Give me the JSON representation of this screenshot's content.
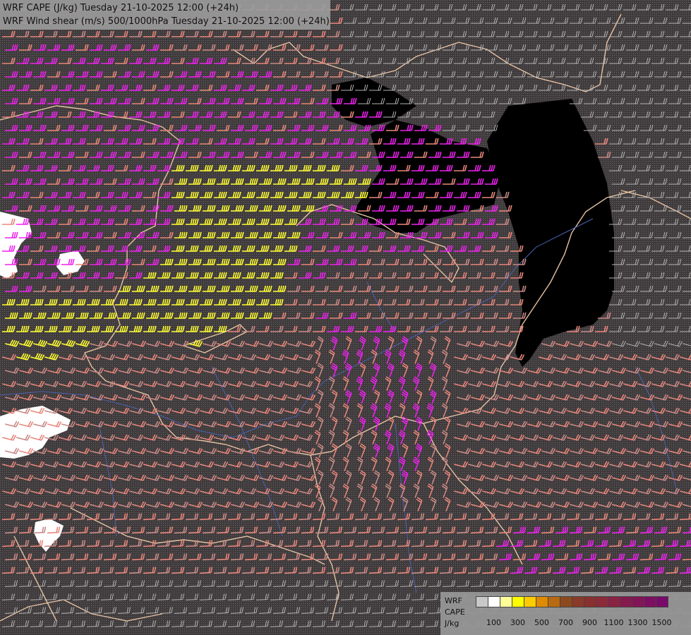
{
  "header": {
    "title_line1": "WRF CAPE (J/kg) Tuesday 21-10-2025 12:00 (+24h)",
    "title_line2": "WRF Wind shear (m/s) 500/1000hPa Tuesday 21-10-2025 12:00 (+24h)"
  },
  "legend": {
    "labels": [
      "WRF",
      "CAPE",
      "J/kg"
    ],
    "swatches": [
      "#c8c8c8",
      "#ffffff",
      "#ffff99",
      "#ffff00",
      "#ffcc00",
      "#e08a00",
      "#b86a10",
      "#8c4a1e",
      "#8a3a28",
      "#8a3030",
      "#8c2a3a",
      "#8a2244",
      "#861a4e",
      "#821458",
      "#7e0e62",
      "#7a0a6a"
    ],
    "ticks": [
      "100",
      "300",
      "500",
      "700",
      "900",
      "1100",
      "1300",
      "1500"
    ]
  },
  "colors": {
    "background": "#3f3a3b",
    "dark_region": "#000000",
    "border_line": "#e6c3a3",
    "river_line": "#4a62b4",
    "barb_grey": "#b4b4b4",
    "barb_salmon": "#e8877c",
    "barb_magenta": "#ee22ee",
    "barb_yellow": "#ffff33"
  },
  "map": {
    "fields": [
      "CAPE",
      "Wind shear 500/1000hPa"
    ],
    "unit_cape": "J/kg",
    "unit_shear": "m/s"
  }
}
